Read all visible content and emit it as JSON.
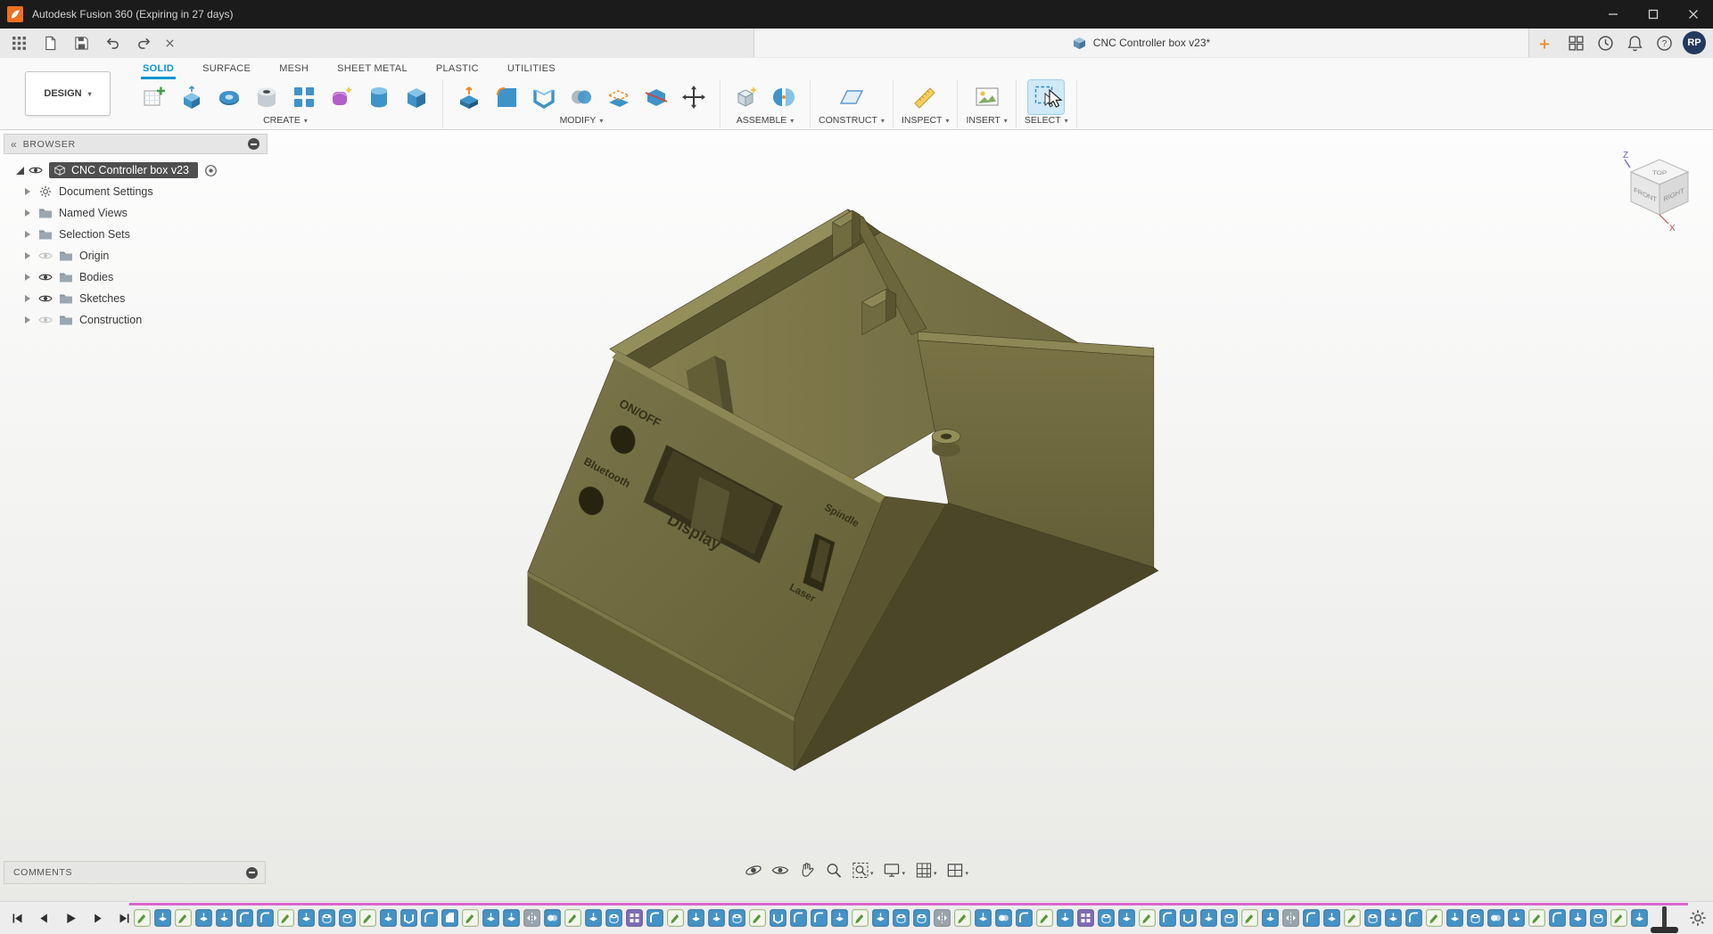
{
  "window": {
    "title": "Autodesk Fusion 360 (Expiring in 27 days)"
  },
  "app_bar": {
    "qat_icons": [
      "app-grid",
      "file-menu",
      "save",
      "undo",
      "redo"
    ],
    "document_tab": {
      "label": "CNC Controller box v23*"
    },
    "account_icons": [
      "extensions",
      "job-status",
      "notifications",
      "help"
    ],
    "avatar": "RP"
  },
  "ribbon": {
    "workspace_selector": "DESIGN",
    "tabs": [
      {
        "label": "SOLID",
        "active": true
      },
      {
        "label": "SURFACE",
        "active": false
      },
      {
        "label": "MESH",
        "active": false
      },
      {
        "label": "SHEET METAL",
        "active": false
      },
      {
        "label": "PLASTIC",
        "active": false
      },
      {
        "label": "UTILITIES",
        "active": false
      }
    ],
    "groups": [
      {
        "label": "CREATE",
        "icons": [
          "create-sketch",
          "extrude",
          "revolve",
          "hole",
          "pattern",
          "create-form",
          "cylinder-primitive",
          "box-primitive"
        ]
      },
      {
        "label": "MODIFY",
        "icons": [
          "press-pull",
          "fillet",
          "shell",
          "combine",
          "offset-face",
          "split-body",
          "move-copy"
        ]
      },
      {
        "label": "ASSEMBLE",
        "icons": [
          "new-component",
          "joint"
        ]
      },
      {
        "label": "CONSTRUCT",
        "icons": [
          "construction-plane"
        ]
      },
      {
        "label": "INSPECT",
        "icons": [
          "measure"
        ]
      },
      {
        "label": "INSERT",
        "icons": [
          "insert-canvas"
        ]
      },
      {
        "label": "SELECT",
        "icons": [
          "select-tool"
        ]
      }
    ]
  },
  "browser": {
    "header": "BROWSER",
    "root": {
      "label": "CNC Controller box v23"
    },
    "items": [
      {
        "label": "Document Settings",
        "icon": "gear",
        "eye": "none"
      },
      {
        "label": "Named Views",
        "icon": "folder",
        "eye": "none"
      },
      {
        "label": "Selection Sets",
        "icon": "folder",
        "eye": "none"
      },
      {
        "label": "Origin",
        "icon": "folder",
        "eye": "off"
      },
      {
        "label": "Bodies",
        "icon": "folder",
        "eye": "on"
      },
      {
        "label": "Sketches",
        "icon": "folder",
        "eye": "on"
      },
      {
        "label": "Construction",
        "icon": "folder",
        "eye": "off"
      }
    ]
  },
  "viewcube": {
    "top": "TOP",
    "front": "FRONT",
    "right": "RIGHT",
    "axis_z": "Z",
    "axis_x": "X"
  },
  "canvas_model": {
    "name": "CNC controller box 3D model",
    "panel_labels": {
      "onoff": "ON/OFF",
      "bluetooth": "Bluetooth",
      "display": "Display",
      "spindle": "Spindle",
      "laser": "Laser"
    },
    "colors": {
      "light": "#948e5b",
      "mid": "#726c3f",
      "dark": "#57522e",
      "darker": "#4b4628"
    }
  },
  "comments_bar": {
    "label": "COMMENTS"
  },
  "nav_bar": {
    "icons": [
      {
        "name": "orbit",
        "dropdown": false
      },
      {
        "name": "look-at",
        "dropdown": false
      },
      {
        "name": "pan",
        "dropdown": false
      },
      {
        "name": "zoom",
        "dropdown": false
      },
      {
        "name": "fit",
        "dropdown": true
      },
      {
        "name": "display-settings",
        "dropdown": true
      },
      {
        "name": "grid-settings",
        "dropdown": true
      },
      {
        "name": "viewports",
        "dropdown": true
      }
    ]
  },
  "timeline": {
    "playback_icons": [
      "skip-start",
      "step-back",
      "play",
      "step-forward",
      "skip-end"
    ],
    "features": [
      "sketch",
      "extrude",
      "sketch",
      "extrude",
      "extrude",
      "fillet",
      "fillet",
      "sketch",
      "extrude",
      "hole",
      "hole",
      "sketch",
      "extrude",
      "shell",
      "fillet",
      "chamfer",
      "sketch",
      "extrude",
      "extrude",
      "mirror",
      "combine",
      "sketch",
      "extrude",
      "hole",
      "pattern",
      "fillet",
      "sketch",
      "extrude",
      "extrude",
      "hole",
      "sketch",
      "shell",
      "fillet",
      "fillet",
      "extrude",
      "sketch",
      "extrude",
      "hole",
      "hole",
      "mirror",
      "sketch",
      "extrude",
      "combine",
      "fillet",
      "sketch",
      "extrude",
      "pattern",
      "hole",
      "extrude",
      "sketch",
      "fillet",
      "shell",
      "extrude",
      "hole",
      "sketch",
      "extrude",
      "mirror",
      "fillet",
      "extrude",
      "sketch",
      "hole",
      "extrude",
      "fillet",
      "sketch",
      "extrude",
      "hole",
      "combine",
      "extrude",
      "sketch",
      "fillet",
      "extrude",
      "hole",
      "sketch",
      "extrude"
    ],
    "settings_icon": "gear"
  }
}
